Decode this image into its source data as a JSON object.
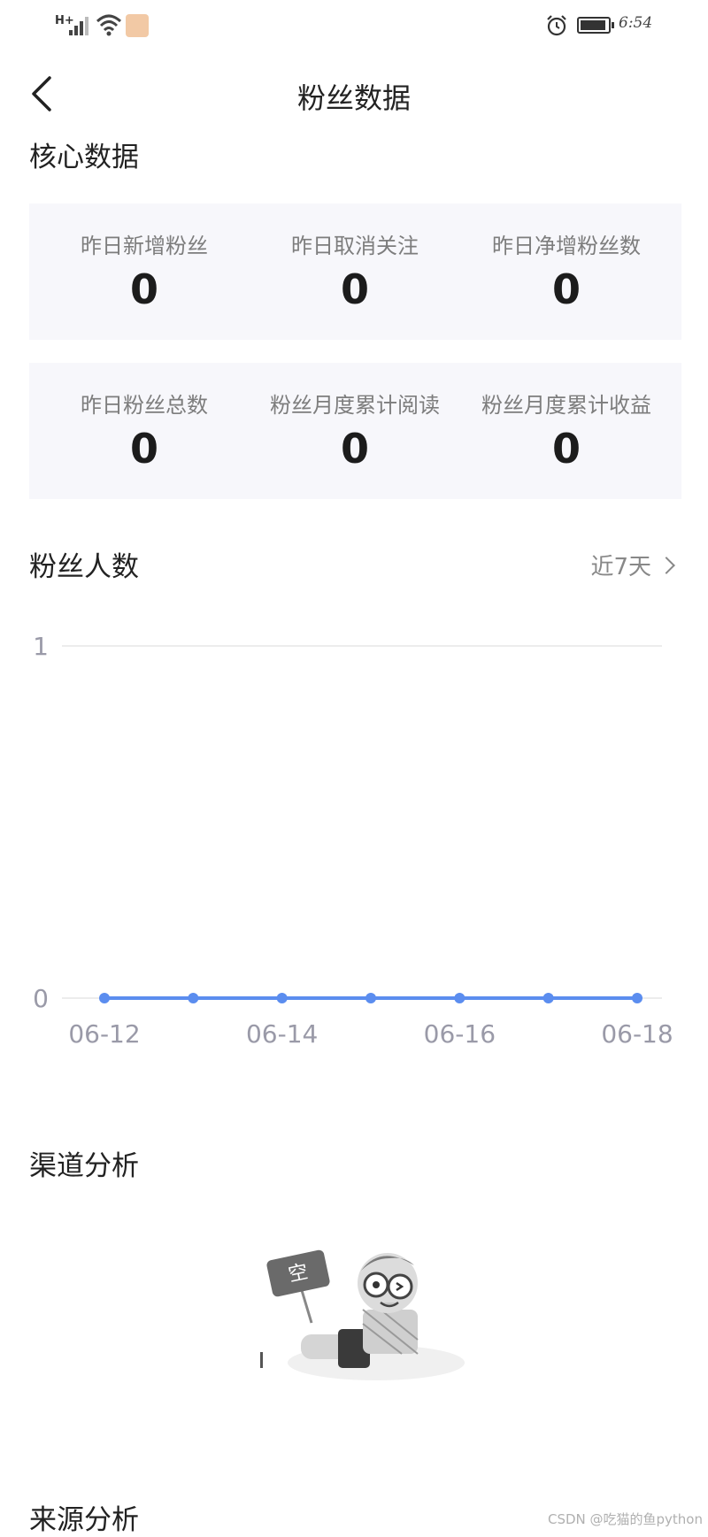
{
  "status_bar": {
    "network": "H+",
    "time": "6:54"
  },
  "nav": {
    "title": "粉丝数据"
  },
  "core": {
    "title": "核心数据",
    "row1": [
      {
        "label": "昨日新增粉丝",
        "value": "0"
      },
      {
        "label": "昨日取消关注",
        "value": "0"
      },
      {
        "label": "昨日净增粉丝数",
        "value": "0"
      }
    ],
    "row2": [
      {
        "label": "昨日粉丝总数",
        "value": "0"
      },
      {
        "label": "粉丝月度累计阅读",
        "value": "0"
      },
      {
        "label": "粉丝月度累计收益",
        "value": "0"
      }
    ]
  },
  "fans_count": {
    "title": "粉丝人数",
    "range_label": "近7天"
  },
  "chart_data": {
    "type": "line",
    "x": [
      "06-12",
      "06-13",
      "06-14",
      "06-15",
      "06-16",
      "06-17",
      "06-18"
    ],
    "x_tick_labels": [
      "06-12",
      "06-14",
      "06-16",
      "06-18"
    ],
    "y_ticks": [
      "0",
      "1"
    ],
    "ylim": [
      0,
      1
    ],
    "series": [
      {
        "values": [
          0,
          0,
          0,
          0,
          0,
          0,
          0
        ]
      }
    ],
    "color": "#5b8def",
    "grid": true
  },
  "channel": {
    "title": "渠道分析",
    "empty_sign": "空"
  },
  "source": {
    "title": "来源分析"
  },
  "watermark": "CSDN @吃猫的鱼python"
}
